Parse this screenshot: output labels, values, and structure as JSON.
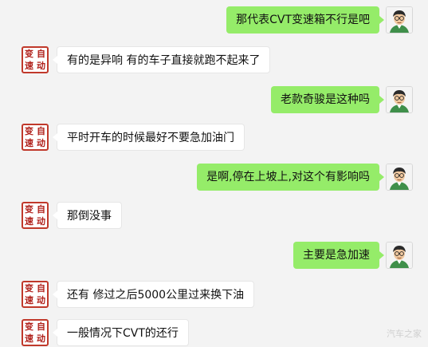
{
  "messages": [
    {
      "sender": "me",
      "text": "那代表CVT变速箱不行是吧"
    },
    {
      "sender": "other",
      "text": "有的是异响  有的车子直接就跑不起来了"
    },
    {
      "sender": "me",
      "text": "老款奇骏是这种吗"
    },
    {
      "sender": "other",
      "text": "平时开车的时候最好不要急加油门"
    },
    {
      "sender": "me",
      "text": "是啊,停在上坡上,对这个有影响吗"
    },
    {
      "sender": "other",
      "text": "那倒没事"
    },
    {
      "sender": "me",
      "text": "主要是急加速"
    },
    {
      "sender": "other",
      "text": "还有  修过之后5000公里过来换下油"
    },
    {
      "sender": "other",
      "text": "一般情况下CVT的还行"
    }
  ],
  "shop_avatar_chars": [
    "变",
    "自",
    "速",
    "动"
  ],
  "watermark": "汽车之家",
  "colors": {
    "me_bubble": "#95ec69",
    "other_bubble": "#ffffff",
    "background": "#f3f3f3",
    "shop_red": "#b0201a"
  }
}
